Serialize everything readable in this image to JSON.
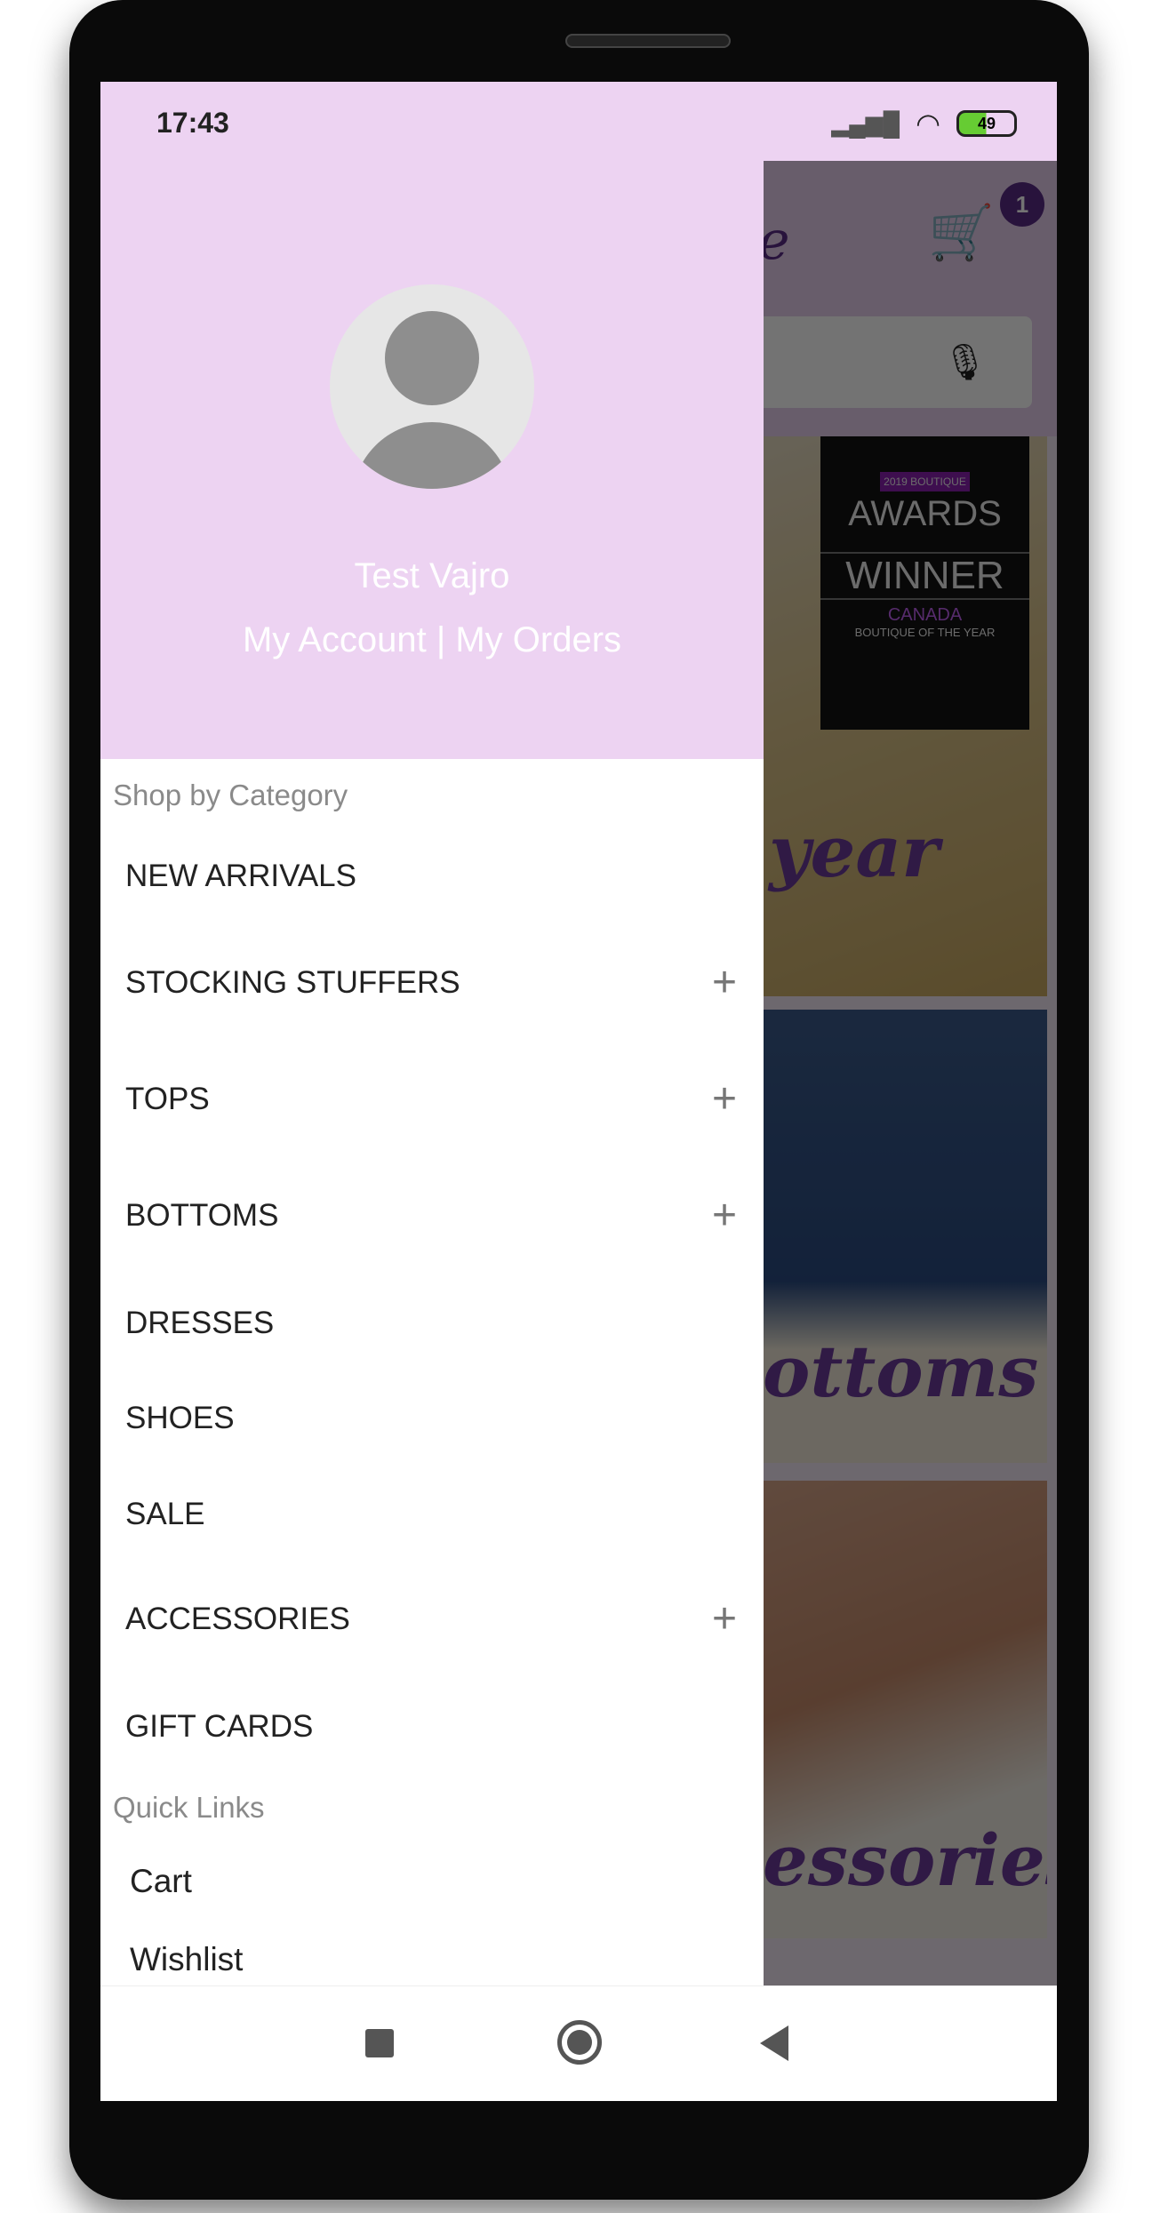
{
  "status": {
    "time": "17:43",
    "battery": "49"
  },
  "app": {
    "cart_count": "1",
    "logo_fragment": "e"
  },
  "banners": {
    "award_top": "AWARDS",
    "award_tag": "2019 BOUTIQUE",
    "award_winner": "WINNER",
    "award_country": "CANADA",
    "award_sub": "BOUTIQUE OF THE YEAR",
    "banner1": "year",
    "banner2": "ottoms",
    "banner3": "essories"
  },
  "drawer": {
    "user_name": "Test Vajro",
    "account_links": "My Account | My Orders",
    "section_shop": "Shop by Category",
    "categories": [
      {
        "label": "NEW ARRIVALS",
        "expandable": false
      },
      {
        "label": "STOCKING STUFFERS",
        "expandable": true
      },
      {
        "label": "TOPS",
        "expandable": true
      },
      {
        "label": "BOTTOMS",
        "expandable": true
      },
      {
        "label": "DRESSES",
        "expandable": false
      },
      {
        "label": "SHOES",
        "expandable": false
      },
      {
        "label": "SALE",
        "expandable": false
      },
      {
        "label": "ACCESSORIES",
        "expandable": true
      },
      {
        "label": "GIFT CARDS",
        "expandable": false
      }
    ],
    "section_quick": "Quick Links",
    "quick_links": [
      "Cart",
      "Wishlist"
    ],
    "expand_symbol": "+"
  },
  "colors": {
    "header": "#edd3f2",
    "badge": "#5a2a86"
  }
}
